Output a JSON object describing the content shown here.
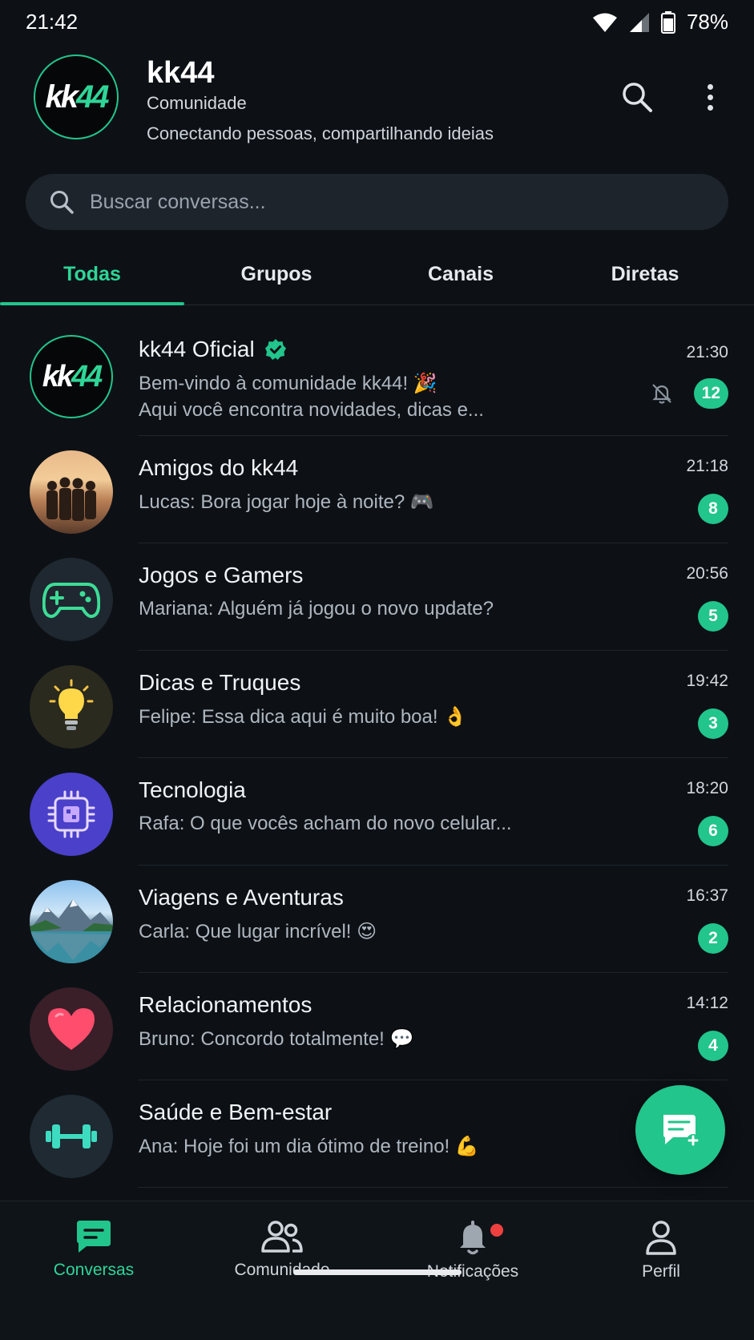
{
  "status_bar": {
    "time": "21:42",
    "battery": "78%"
  },
  "header": {
    "logo_text_left": "kk",
    "logo_text_right": "44",
    "name": "kk44",
    "type": "Comunidade",
    "description": "Conectando pessoas, compartilhando ideias"
  },
  "search": {
    "placeholder": "Buscar conversas..."
  },
  "tabs": [
    {
      "label": "Todas"
    },
    {
      "label": "Grupos"
    },
    {
      "label": "Canais"
    },
    {
      "label": "Diretas"
    }
  ],
  "chats": [
    {
      "name": "kk44 Oficial",
      "verified": true,
      "line1": "Bem-vindo à comunidade kk44! 🎉",
      "line2": "Aqui você encontra novidades, dicas e...",
      "time": "21:30",
      "unread": "12",
      "muted": true,
      "avatar": "kk44-logo"
    },
    {
      "name": "Amigos do kk44",
      "message": "Lucas: Bora jogar hoje à noite? 🎮",
      "time": "21:18",
      "unread": "8",
      "avatar": "friends-photo"
    },
    {
      "name": "Jogos e Gamers",
      "message": "Mariana: Alguém já jogou o novo update?",
      "time": "20:56",
      "unread": "5",
      "avatar": "gamepad-icon"
    },
    {
      "name": "Dicas e Truques",
      "message": "Felipe: Essa dica aqui é muito boa! 👌",
      "time": "19:42",
      "unread": "3",
      "avatar": "lightbulb-icon"
    },
    {
      "name": "Tecnologia",
      "message": "Rafa: O que vocês acham do novo celular...",
      "time": "18:20",
      "unread": "6",
      "avatar": "chip-icon"
    },
    {
      "name": "Viagens e Aventuras",
      "message": "Carla: Que lugar incrível! 😍",
      "time": "16:37",
      "unread": "2",
      "avatar": "mountain-lake-photo"
    },
    {
      "name": "Relacionamentos",
      "message": "Bruno: Concordo totalmente! 💬",
      "time": "14:12",
      "unread": "4",
      "avatar": "heart-icon"
    },
    {
      "name": "Saúde e Bem-estar",
      "message": "Ana: Hoje foi um dia ótimo de treino! 💪",
      "time": "",
      "unread": "",
      "avatar": "dumbbell-icon"
    }
  ],
  "bottom_nav": [
    {
      "label": "Conversas"
    },
    {
      "label": "Comunidade"
    },
    {
      "label": "Notificações"
    },
    {
      "label": "Perfil"
    }
  ],
  "colors": {
    "accent": "#22c58b",
    "background": "#0d1116",
    "notification_dot": "#ef4040"
  }
}
